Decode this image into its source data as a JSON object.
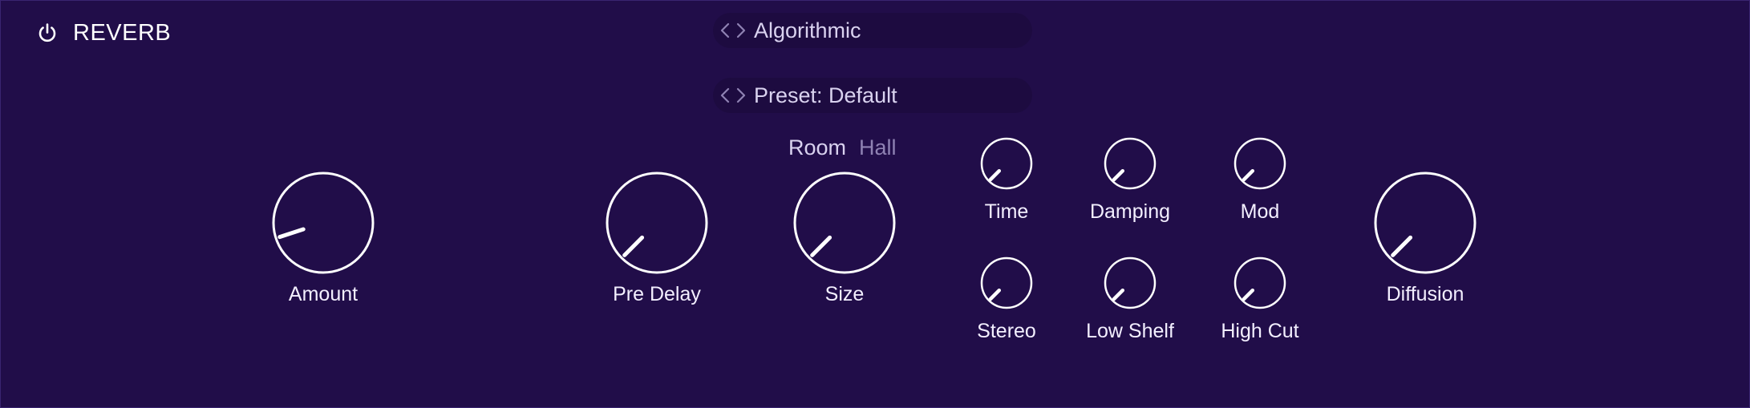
{
  "header": {
    "title": "REVERB",
    "power_icon": "power-icon"
  },
  "algorithm_selector": {
    "value": "Algorithmic",
    "icon": "chevron-left-right-icon"
  },
  "preset_selector": {
    "value": "Preset: Default",
    "icon": "chevron-left-right-icon"
  },
  "mode_toggle": {
    "options": [
      "Room",
      "Hall"
    ],
    "selected": "Room"
  },
  "knobs": [
    {
      "id": "amount",
      "label": "Amount",
      "value_fraction": 0.1
    },
    {
      "id": "pre-delay",
      "label": "Pre Delay",
      "value_fraction": 0.0
    },
    {
      "id": "size",
      "label": "Size",
      "value_fraction": 0.0
    },
    {
      "id": "time",
      "label": "Time",
      "value_fraction": 0.0
    },
    {
      "id": "damping",
      "label": "Damping",
      "value_fraction": 0.0
    },
    {
      "id": "mod",
      "label": "Mod",
      "value_fraction": 0.0
    },
    {
      "id": "stereo",
      "label": "Stereo",
      "value_fraction": 0.0
    },
    {
      "id": "low-shelf",
      "label": "Low Shelf",
      "value_fraction": 0.0
    },
    {
      "id": "high-cut",
      "label": "High Cut",
      "value_fraction": 0.0
    },
    {
      "id": "diffusion",
      "label": "Diffusion",
      "value_fraction": 0.0
    }
  ],
  "colors": {
    "background": "#210d49",
    "selector_background": "#1d0b40",
    "knob_stroke": "#ffffff",
    "label_active": "#d9d2ef",
    "label_inactive": "#8f82b3"
  }
}
